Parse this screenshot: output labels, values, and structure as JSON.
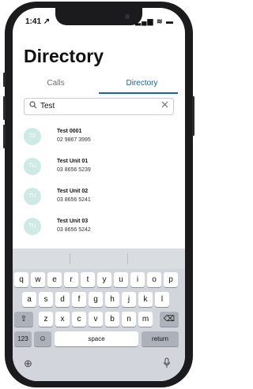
{
  "status_bar": {
    "time": "1:41",
    "location_glyph": "↗",
    "signal_icons": "▂▄▆ ≋ ▬"
  },
  "page": {
    "title": "Directory"
  },
  "tabs": [
    {
      "label": "Calls",
      "active": false
    },
    {
      "label": "Directory",
      "active": true
    }
  ],
  "search": {
    "icon": "search-icon",
    "value": "Test",
    "clear_icon": "close-icon"
  },
  "contacts": [
    {
      "initials": "T0",
      "name": "Test 0001",
      "number": "02 9867 3995"
    },
    {
      "initials": "TU",
      "name": "Test Unit 01",
      "number": "03 8656 5239"
    },
    {
      "initials": "TU",
      "name": "Test Unit 02",
      "number": "03 8656 5241"
    },
    {
      "initials": "TU",
      "name": "Test Unit 03",
      "number": "03 8656 5242"
    }
  ],
  "keyboard": {
    "row1": [
      "q",
      "w",
      "e",
      "r",
      "t",
      "y",
      "u",
      "i",
      "o",
      "p"
    ],
    "row2": [
      "a",
      "s",
      "d",
      "f",
      "g",
      "h",
      "j",
      "k",
      "l"
    ],
    "row3": [
      "z",
      "x",
      "c",
      "v",
      "b",
      "n",
      "m"
    ],
    "shift_glyph": "⇧",
    "delete_glyph": "⌫",
    "numbers_label": "123",
    "emoji_glyph": "☺",
    "space_label": "space",
    "return_label": "return",
    "globe_glyph": "⊕",
    "mic_glyph": "🎙"
  },
  "colors": {
    "accent": "#1a5fa8",
    "avatar": "#cfe9e4"
  }
}
